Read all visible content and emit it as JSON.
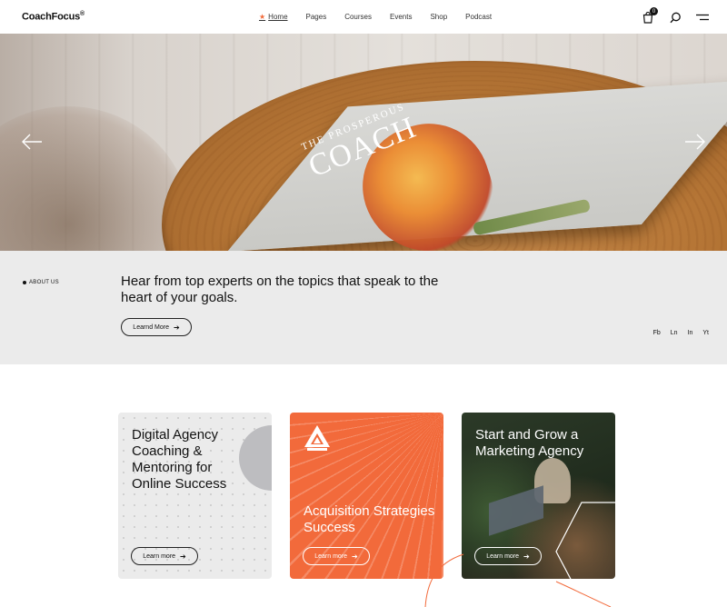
{
  "brand": {
    "name": "CoachFocus",
    "mark": "®"
  },
  "nav": {
    "items": [
      {
        "label": "Home",
        "active": true
      },
      {
        "label": "Pages"
      },
      {
        "label": "Courses"
      },
      {
        "label": "Events"
      },
      {
        "label": "Shop"
      },
      {
        "label": "Podcast"
      }
    ]
  },
  "header_icons": {
    "cart": "cart-icon",
    "cart_count": "0",
    "search": "search-icon",
    "menu": "menu-icon"
  },
  "hero": {
    "book_title_small": "THE PROSPEROUS",
    "book_title_large": "COACH",
    "prev_icon": "arrow-left-icon",
    "next_icon": "arrow-right-icon"
  },
  "about": {
    "label": "ABOUT US",
    "text": "Hear from top experts on the topics that speak to the heart of your goals.",
    "button_label": "Learnd More",
    "socials": [
      "Fb",
      "Ln",
      "In",
      "Yt"
    ]
  },
  "cards": [
    {
      "title": "Digital Agency Coaching & Mentoring for Online Success",
      "button_label": "Learn more"
    },
    {
      "title": "Acquisition Strategies Success",
      "button_label": "Learn more"
    },
    {
      "title": "Start and Grow a Marketing Agency",
      "button_label": "Learn more"
    }
  ],
  "colors": {
    "accent": "#f26a3b",
    "text": "#111111",
    "band": "#ebebeb"
  }
}
